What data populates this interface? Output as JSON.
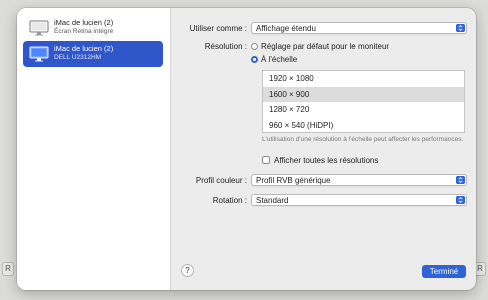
{
  "sidebar": {
    "displays": [
      {
        "name": "iMac de lucien (2)",
        "subtitle": "Écran Retina intégré",
        "selected": false
      },
      {
        "name": "iMac de lucien (2)",
        "subtitle": "DELL U2312HM",
        "selected": true
      }
    ]
  },
  "settings": {
    "use_as": {
      "label": "Utiliser comme :",
      "value": "Affichage étendu"
    },
    "resolution": {
      "label": "Résolution :",
      "options": [
        {
          "label": "Réglage par défaut pour le moniteur",
          "checked": false
        },
        {
          "label": "À l'échelle",
          "checked": true
        }
      ],
      "list": [
        {
          "label": "1920 × 1080",
          "selected": false
        },
        {
          "label": "1600 × 900",
          "selected": true
        },
        {
          "label": "1280 × 720",
          "selected": false
        },
        {
          "label": "960 × 540 (HiDPI)",
          "selected": false
        }
      ],
      "note": "L'utilisation d'une résolution à l'échelle peut affecter les performances.",
      "show_all": {
        "label": "Afficher toutes les résolutions",
        "checked": false
      }
    },
    "color_profile": {
      "label": "Profil couleur :",
      "value": "Profil RVB générique"
    },
    "rotation": {
      "label": "Rotation :",
      "value": "Standard"
    }
  },
  "footer": {
    "help": "?",
    "done": "Terminé"
  },
  "colors": {
    "accent": "#2f63d8",
    "selection": "#2f57c9"
  }
}
